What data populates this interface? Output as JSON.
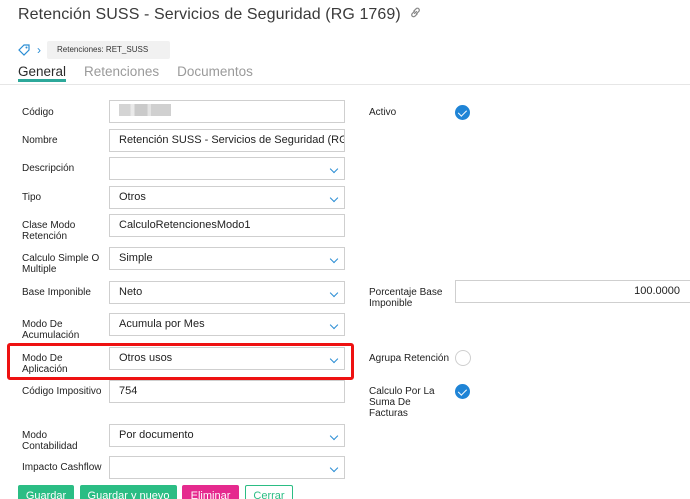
{
  "header": {
    "title": "Retención SUSS - Servicios de Seguridad (RG 1769)",
    "link_icon": "link-icon"
  },
  "breadcrumb": {
    "icon": "tag-icon",
    "separator": "›",
    "item": "Retenciones: RET_SUSS"
  },
  "tabs": [
    {
      "label": "General",
      "active": true
    },
    {
      "label": "Retenciones",
      "active": false
    },
    {
      "label": "Documentos",
      "active": false
    }
  ],
  "form": {
    "codigo": {
      "label": "Código",
      "value": ""
    },
    "nombre": {
      "label": "Nombre",
      "value": "Retención SUSS - Servicios de Seguridad (RG"
    },
    "descripcion": {
      "label": "Descripción",
      "value": ""
    },
    "tipo": {
      "label": "Tipo",
      "value": "Otros"
    },
    "clase_modo": {
      "label_1": "Clase Modo",
      "label_2": "Retención",
      "value": "CalculoRetencionesModo1"
    },
    "calculo": {
      "label_1": "Calculo Simple O",
      "label_2": "Multiple",
      "value": "Simple"
    },
    "base_imponible": {
      "label": "Base Imponible",
      "value": "Neto"
    },
    "modo_acumulacion": {
      "label_1": "Modo De",
      "label_2": "Acumulación",
      "value": "Acumula por Mes"
    },
    "modo_aplicacion": {
      "label_1": "Modo De",
      "label_2": "Aplicación",
      "value": "Otros usos"
    },
    "codigo_impositivo": {
      "label": "Código Impositivo",
      "value": "754"
    },
    "modo_contabilidad": {
      "label_1": "Modo",
      "label_2": "Contabilidad",
      "value": "Por documento"
    },
    "impacto_cashflow": {
      "label": "Impacto Cashflow",
      "value": ""
    }
  },
  "right": {
    "activo": {
      "label": "Activo",
      "checked": true
    },
    "porcentaje": {
      "label_1": "Porcentaje Base",
      "label_2": "Imponible",
      "value": "100.0000"
    },
    "agrupa": {
      "label": "Agrupa Retención",
      "checked": false
    },
    "calculo_suma": {
      "label_1": "Calculo Por La",
      "label_2": "Suma De",
      "label_3": "Facturas",
      "checked": true
    }
  },
  "buttons": {
    "guardar": "Guardar",
    "guardar_nuevo": "Guardar y nuevo",
    "eliminar": "Eliminar",
    "cerrar": "Cerrar"
  },
  "colors": {
    "accent": "#2da89a",
    "primary_blue": "#1f84d6",
    "button_green": "#2bbd84",
    "button_pink": "#e52a8e",
    "highlight_red": "#ee1111"
  }
}
